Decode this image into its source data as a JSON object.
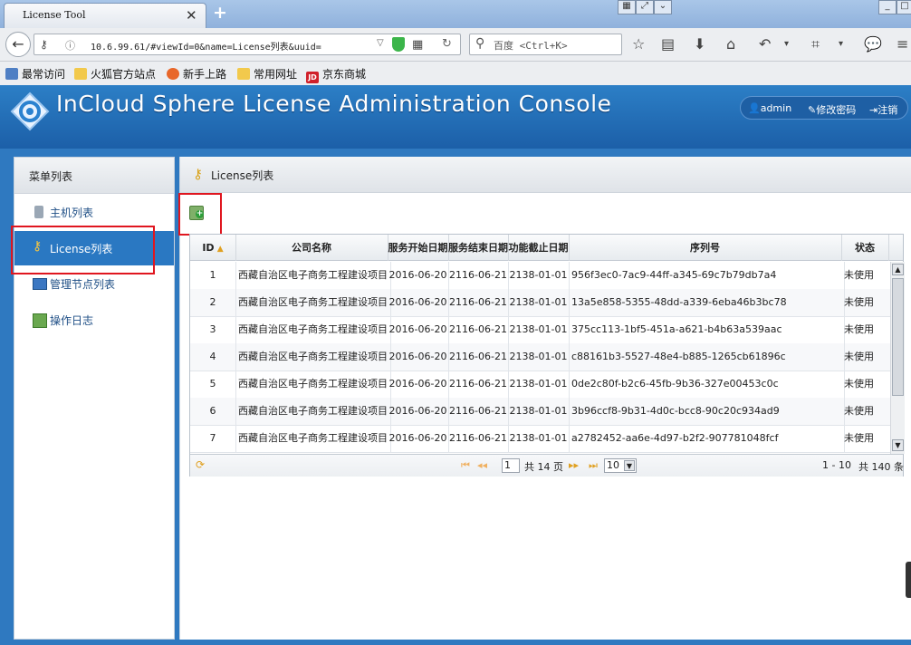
{
  "browser": {
    "tab_title": "License Tool",
    "url": "10.6.99.61/#viewId=0&name=License列表&uuid=",
    "search_placeholder": "百度 <Ctrl+K>",
    "bookmarks": [
      "最常访问",
      "火狐官方站点",
      "新手上路",
      "常用网址",
      "京东商城"
    ]
  },
  "header": {
    "title": "InCloud Sphere License Administration Console",
    "user": "admin",
    "change_password": "修改密码",
    "logout": "注销"
  },
  "sidebar": {
    "title": "菜单列表",
    "items": [
      {
        "label": "主机列表",
        "icon": "server-icon",
        "active": false
      },
      {
        "label": "License列表",
        "icon": "key-icon",
        "active": true
      },
      {
        "label": "管理节点列表",
        "icon": "monitor-icon",
        "active": false
      },
      {
        "label": "操作日志",
        "icon": "log-icon",
        "active": false
      }
    ]
  },
  "main": {
    "title": "License列表",
    "add_button_icon": "add-license-icon"
  },
  "grid": {
    "columns": [
      "ID",
      "公司名称",
      "服务开始日期",
      "服务结束日期",
      "功能截止日期",
      "序列号",
      "状态"
    ],
    "rows": [
      {
        "id": "1",
        "company": "西藏自治区电子商务工程建设项目",
        "start": "2016-06-20",
        "end": "2116-06-21",
        "func_end": "2138-01-01",
        "serial": "956f3ec0-7ac9-44ff-a345-69c7b79db7a4",
        "status": "未使用"
      },
      {
        "id": "2",
        "company": "西藏自治区电子商务工程建设项目",
        "start": "2016-06-20",
        "end": "2116-06-21",
        "func_end": "2138-01-01",
        "serial": "13a5e858-5355-48dd-a339-6eba46b3bc78",
        "status": "未使用"
      },
      {
        "id": "3",
        "company": "西藏自治区电子商务工程建设项目",
        "start": "2016-06-20",
        "end": "2116-06-21",
        "func_end": "2138-01-01",
        "serial": "375cc113-1bf5-451a-a621-b4b63a539aac",
        "status": "未使用"
      },
      {
        "id": "4",
        "company": "西藏自治区电子商务工程建设项目",
        "start": "2016-06-20",
        "end": "2116-06-21",
        "func_end": "2138-01-01",
        "serial": "c88161b3-5527-48e4-b885-1265cb61896c",
        "status": "未使用"
      },
      {
        "id": "5",
        "company": "西藏自治区电子商务工程建设项目",
        "start": "2016-06-20",
        "end": "2116-06-21",
        "func_end": "2138-01-01",
        "serial": "0de2c80f-b2c6-45fb-9b36-327e00453c0c",
        "status": "未使用"
      },
      {
        "id": "6",
        "company": "西藏自治区电子商务工程建设项目",
        "start": "2016-06-20",
        "end": "2116-06-21",
        "func_end": "2138-01-01",
        "serial": "3b96ccf8-9b31-4d0c-bcc8-90c20c934ad9",
        "status": "未使用"
      },
      {
        "id": "7",
        "company": "西藏自治区电子商务工程建设项目",
        "start": "2016-06-20",
        "end": "2116-06-21",
        "func_end": "2138-01-01",
        "serial": "a2782452-aa6e-4d97-b2f2-907781048fcf",
        "status": "未使用"
      }
    ]
  },
  "pager": {
    "page": "1",
    "total_pages_text": "共 14 页",
    "page_size": "10",
    "range_text": "1 - 10",
    "total_text": "共 140 条"
  }
}
